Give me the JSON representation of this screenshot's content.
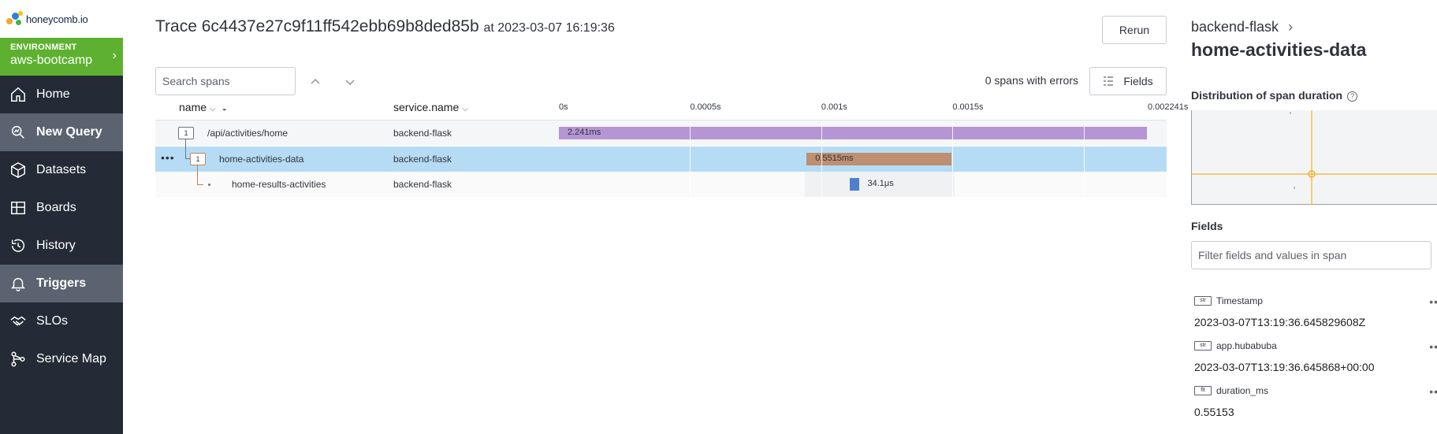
{
  "app": {
    "logo_text": "honeycomb.io"
  },
  "environment": {
    "label": "ENVIRONMENT",
    "name": "aws-bootcamp"
  },
  "nav": [
    {
      "label": "Home",
      "icon": "home-icon"
    },
    {
      "label": "New Query",
      "icon": "query-icon"
    },
    {
      "label": "Datasets",
      "icon": "cube-icon"
    },
    {
      "label": "Boards",
      "icon": "board-icon"
    },
    {
      "label": "History",
      "icon": "history-icon"
    },
    {
      "label": "Triggers",
      "icon": "bell-icon"
    },
    {
      "label": "SLOs",
      "icon": "handshake-icon"
    },
    {
      "label": "Service Map",
      "icon": "service-map-icon"
    }
  ],
  "trace": {
    "title": "Trace 6c4437e27c9f11ff542ebb69b8ded85b",
    "at_text": "at 2023-03-07 16:19:36",
    "rerun_label": "Rerun",
    "search_placeholder": "Search spans",
    "errors_text": "0 spans with errors",
    "fields_label": "Fields",
    "columns": {
      "name": "name",
      "service": "service.name"
    },
    "ticks": [
      "0s",
      "0.0005s",
      "0.001s",
      "0.0015s",
      "0.002241s"
    ],
    "total_seconds": 0.002241,
    "spans": [
      {
        "count": "1",
        "name": "/api/activities/home",
        "service": "backend-flask",
        "duration_label": "2.241ms",
        "start_s": 0.0,
        "duration_s": 0.002241,
        "color": "#b595d4"
      },
      {
        "count": "1",
        "name": "home-activities-data",
        "service": "backend-flask",
        "duration_label": "0.5515ms",
        "start_s": 0.000944,
        "duration_s": 0.0005515,
        "color": "#be8f70"
      },
      {
        "count": "",
        "name": "home-results-activities",
        "service": "backend-flask",
        "duration_label": "34.1μs",
        "start_s": 0.001107,
        "duration_s": 3.41e-05,
        "color": "#4f7fcf"
      }
    ]
  },
  "panel": {
    "service": "backend-flask",
    "span_name": "home-activities-data",
    "distribution_title": "Distribution of span duration",
    "fields_title": "Fields",
    "filter_placeholder": "Filter fields and values in span",
    "fields": [
      {
        "type": "str",
        "key": "Timestamp",
        "value": "2023-03-07T13:19:36.645829608Z"
      },
      {
        "type": "str",
        "key": "app.hubabuba",
        "value": "2023-03-07T13:19:36.645868+00:00"
      },
      {
        "type": "flt",
        "key": "duration_ms",
        "value": "0.55153"
      }
    ]
  },
  "colors": {
    "sidebar": "#252b36",
    "environment": "#5eb130",
    "selected_row": "#b6dcf5",
    "crosshair": "#f0b428"
  }
}
